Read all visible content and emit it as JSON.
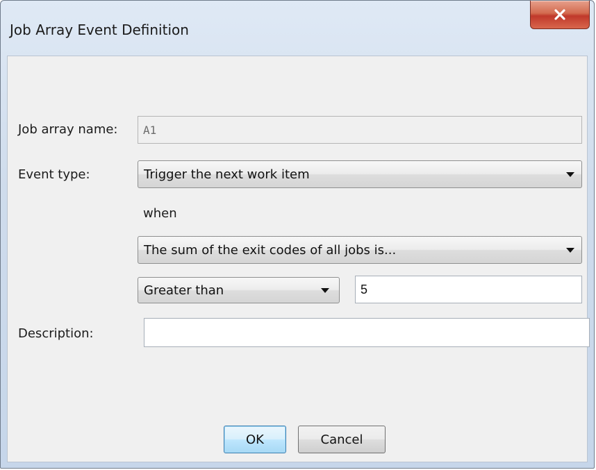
{
  "window": {
    "title": "Job Array Event Definition",
    "close_icon": "close-icon"
  },
  "form": {
    "job_array_name": {
      "label": "Job array name:",
      "value": "A1"
    },
    "event_type": {
      "label": "Event type:",
      "selected": "Trigger the next work item"
    },
    "when_label": "when",
    "condition": {
      "selected": "The sum of the exit codes of all jobs is..."
    },
    "comparator": {
      "selected": "Greater than"
    },
    "threshold": {
      "value": "5"
    },
    "description": {
      "label": "Description:",
      "value": ""
    }
  },
  "buttons": {
    "ok_label": "OK",
    "cancel_label": "Cancel"
  },
  "colors": {
    "close_button": "#c0392b",
    "default_button_border": "#3c7fb1",
    "client_background": "#f0f0f0"
  }
}
